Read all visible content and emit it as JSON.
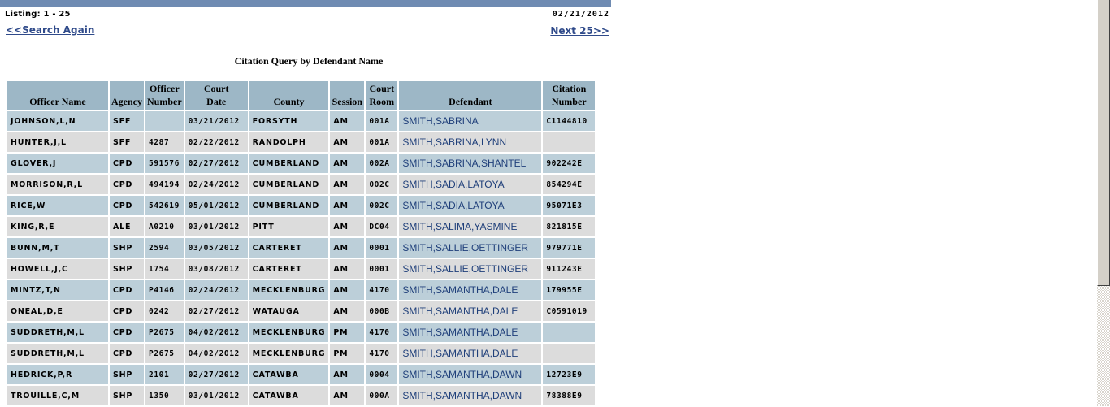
{
  "header": {
    "listing": "Listing: 1 - 25",
    "date": "02/21/2012",
    "search_again": "<<Search Again",
    "next": "Next 25>>",
    "title": "Citation Query by Defendant Name"
  },
  "table": {
    "columns": [
      {
        "line1": "",
        "line2": "Officer Name"
      },
      {
        "line1": "",
        "line2": "Agency"
      },
      {
        "line1": "Officer",
        "line2": "Number"
      },
      {
        "line1": "Court",
        "line2": "Date"
      },
      {
        "line1": "",
        "line2": "County"
      },
      {
        "line1": "",
        "line2": "Session"
      },
      {
        "line1": "Court",
        "line2": "Room"
      },
      {
        "line1": "",
        "line2": "Defendant"
      },
      {
        "line1": "Citation",
        "line2": "Number"
      }
    ],
    "rows": [
      {
        "officer": "JOHNSON,L,N",
        "agency": "SFF",
        "officer_number": "",
        "court_date": "03/21/2012",
        "county": "FORSYTH",
        "session": "AM",
        "court_room": "001A",
        "defendant": "SMITH,SABRINA",
        "citation": "C1144810"
      },
      {
        "officer": "HUNTER,J,L",
        "agency": "SFF",
        "officer_number": "4287",
        "court_date": "02/22/2012",
        "county": "RANDOLPH",
        "session": "AM",
        "court_room": "001A",
        "defendant": "SMITH,SABRINA,LYNN",
        "citation": ""
      },
      {
        "officer": "GLOVER,J",
        "agency": "CPD",
        "officer_number": "591576",
        "court_date": "02/27/2012",
        "county": "CUMBERLAND",
        "session": "AM",
        "court_room": "002A",
        "defendant": "SMITH,SABRINA,SHANTEL",
        "citation": "902242E"
      },
      {
        "officer": "MORRISON,R,L",
        "agency": "CPD",
        "officer_number": "494194",
        "court_date": "02/24/2012",
        "county": "CUMBERLAND",
        "session": "AM",
        "court_room": "002C",
        "defendant": "SMITH,SADIA,LATOYA",
        "citation": "854294E"
      },
      {
        "officer": "RICE,W",
        "agency": "CPD",
        "officer_number": "542619",
        "court_date": "05/01/2012",
        "county": "CUMBERLAND",
        "session": "AM",
        "court_room": "002C",
        "defendant": "SMITH,SADIA,LATOYA",
        "citation": "95071E3"
      },
      {
        "officer": "KING,R,E",
        "agency": "ALE",
        "officer_number": "A0210",
        "court_date": "03/01/2012",
        "county": "PITT",
        "session": "AM",
        "court_room": "DC04",
        "defendant": "SMITH,SALIMA,YASMINE",
        "citation": "821815E"
      },
      {
        "officer": "BUNN,M,T",
        "agency": "SHP",
        "officer_number": "2594",
        "court_date": "03/05/2012",
        "county": "CARTERET",
        "session": "AM",
        "court_room": "0001",
        "defendant": "SMITH,SALLIE,OETTINGER",
        "citation": "979771E"
      },
      {
        "officer": "HOWELL,J,C",
        "agency": "SHP",
        "officer_number": "1754",
        "court_date": "03/08/2012",
        "county": "CARTERET",
        "session": "AM",
        "court_room": "0001",
        "defendant": "SMITH,SALLIE,OETTINGER",
        "citation": "911243E"
      },
      {
        "officer": "MINTZ,T,N",
        "agency": "CPD",
        "officer_number": "P4146",
        "court_date": "02/24/2012",
        "county": "MECKLENBURG",
        "session": "AM",
        "court_room": "4170",
        "defendant": "SMITH,SAMANTHA,DALE",
        "citation": "179955E"
      },
      {
        "officer": "ONEAL,D,E",
        "agency": "CPD",
        "officer_number": "0242",
        "court_date": "02/27/2012",
        "county": "WATAUGA",
        "session": "AM",
        "court_room": "000B",
        "defendant": "SMITH,SAMANTHA,DALE",
        "citation": "C0591019"
      },
      {
        "officer": "SUDDRETH,M,L",
        "agency": "CPD",
        "officer_number": "P2675",
        "court_date": "04/02/2012",
        "county": "MECKLENBURG",
        "session": "PM",
        "court_room": "4170",
        "defendant": "SMITH,SAMANTHA,DALE",
        "citation": ""
      },
      {
        "officer": "SUDDRETH,M,L",
        "agency": "CPD",
        "officer_number": "P2675",
        "court_date": "04/02/2012",
        "county": "MECKLENBURG",
        "session": "PM",
        "court_room": "4170",
        "defendant": "SMITH,SAMANTHA,DALE",
        "citation": ""
      },
      {
        "officer": "HEDRICK,P,R",
        "agency": "SHP",
        "officer_number": "2101",
        "court_date": "02/27/2012",
        "county": "CATAWBA",
        "session": "AM",
        "court_room": "0004",
        "defendant": "SMITH,SAMANTHA,DAWN",
        "citation": "12723E9"
      },
      {
        "officer": "TROUILLE,C,M",
        "agency": "SHP",
        "officer_number": "1350",
        "court_date": "03/01/2012",
        "county": "CATAWBA",
        "session": "AM",
        "court_room": "000A",
        "defendant": "SMITH,SAMANTHA,DAWN",
        "citation": "78388E9"
      }
    ]
  },
  "colors": {
    "topbar": "#6f8bb2",
    "header_bg": "#9db7c6",
    "row_odd": "#bccfd9",
    "row_even": "#dcdcdc",
    "link": "#2f4a8a",
    "defendant_link": "#1f3f7a"
  }
}
